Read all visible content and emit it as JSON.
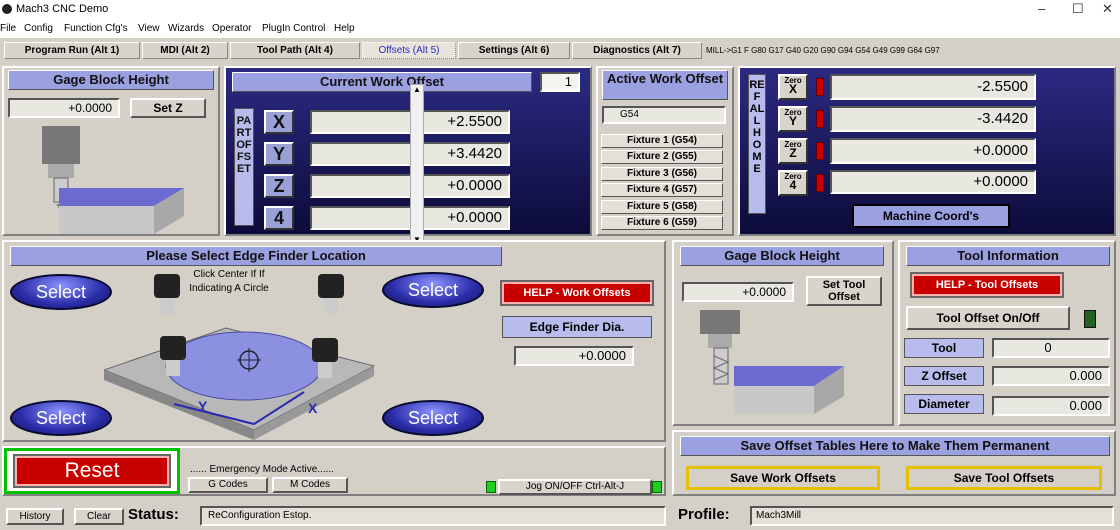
{
  "window": {
    "title": "Mach3 CNC  Demo",
    "min": "–",
    "max": "☐",
    "close": "✕"
  },
  "menu": [
    "File",
    "Config",
    "Function Cfg's",
    "View",
    "Wizards",
    "Operator",
    "PlugIn Control",
    "Help"
  ],
  "tabs": [
    {
      "label": "Program Run (Alt 1)"
    },
    {
      "label": "MDI (Alt 2)"
    },
    {
      "label": "Tool Path (Alt 4)"
    },
    {
      "label": "Offsets (Alt 5)"
    },
    {
      "label": "Settings (Alt 6)"
    },
    {
      "label": "Diagnostics (Alt 7)"
    }
  ],
  "gcode_status": "MILL->G1 F G80 G17 G40 G20 G90 G94 G54 G49 G99 G64 G97",
  "gage_top": {
    "title": "Gage Block Height",
    "value": "+0.0000",
    "set": "Set Z"
  },
  "work_offset": {
    "title": "Current Work Offset",
    "index": "1",
    "side_label": "PART OFFSET",
    "axes": [
      {
        "axis": "X",
        "value": "+2.5500"
      },
      {
        "axis": "Y",
        "value": "+3.4420"
      },
      {
        "axis": "Z",
        "value": "+0.0000"
      },
      {
        "axis": "4",
        "value": "+0.0000"
      }
    ]
  },
  "active_offset": {
    "title": "Active Work Offset",
    "value": "G54",
    "fixtures": [
      "Fixture 1 (G54)",
      "Fixture 2 (G55)",
      "Fixture 3 (G56)",
      "Fixture 4 (G57)",
      "Fixture 5 (G58)",
      "Fixture 6 (G59)"
    ]
  },
  "machine": {
    "side_label": "REF ALL HOME",
    "zero_label": "Zero",
    "axes": [
      {
        "axis": "X",
        "value": "-2.5500"
      },
      {
        "axis": "Y",
        "value": "-3.4420"
      },
      {
        "axis": "Z",
        "value": "+0.0000"
      },
      {
        "axis": "4",
        "value": "+0.0000"
      }
    ],
    "coords_btn": "Machine Coord's"
  },
  "edge": {
    "title": "Please Select Edge Finder Location",
    "select": "Select",
    "center_text": "Click Center If If Indicating A Circle",
    "help": "HELP - Work Offsets",
    "dia_label": "Edge Finder Dia.",
    "dia_value": "+0.0000",
    "axis_y": "Y",
    "axis_x": "X"
  },
  "gage_bottom": {
    "title": "Gage Block Height",
    "value": "+0.0000",
    "set": "Set Tool Offset"
  },
  "tool_info": {
    "title": "Tool Information",
    "help": "HELP - Tool Offsets",
    "toggle": "Tool Offset On/Off",
    "tool_label": "Tool",
    "tool_value": "0",
    "zoff_label": "Z Offset",
    "zoff_value": "0.000",
    "dia_label": "Diameter",
    "dia_value": "0.000"
  },
  "save": {
    "title": "Save Offset Tables Here to Make Them Permanent",
    "work": "Save Work Offsets",
    "tool": "Save Tool Offsets"
  },
  "bottom": {
    "reset": "Reset",
    "emergency": "...... Emergency Mode Active......",
    "gcodes": "G Codes",
    "mcodes": "M Codes",
    "jog": "Jog ON/OFF Ctrl-Alt-J",
    "history": "History",
    "clear": "Clear",
    "status_label": "Status:",
    "status_value": "ReConfiguration Estop.",
    "profile_label": "Profile:",
    "profile_value": "Mach3Mill"
  },
  "colors": {
    "accent_blue": "#9aa0e0",
    "panel_dark": "#1a1860",
    "reset_red": "#c80000",
    "led_green": "#22cc22"
  }
}
